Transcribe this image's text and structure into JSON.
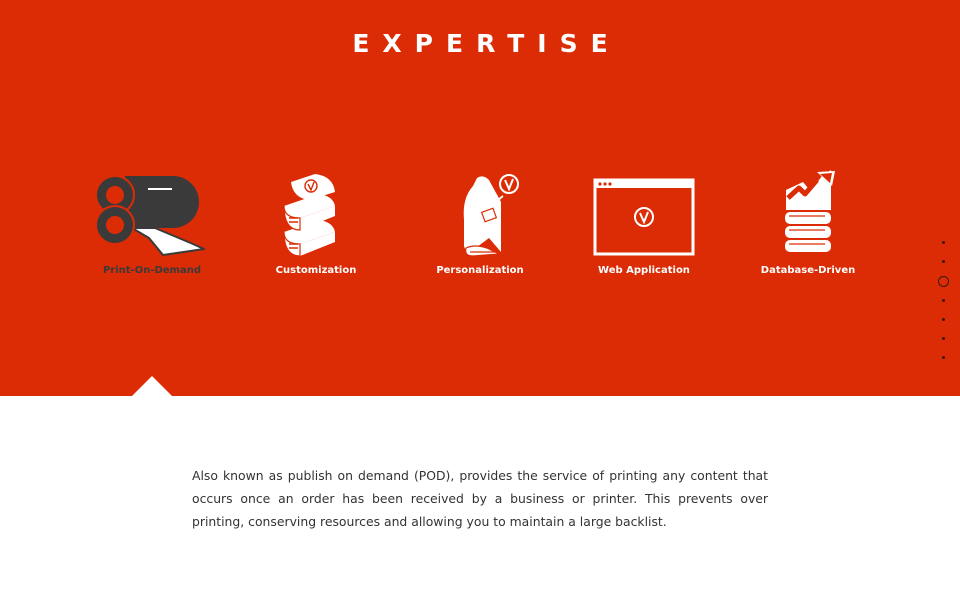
{
  "section": {
    "title": "EXPERTISE"
  },
  "features": [
    {
      "label": "Print-On-Demand",
      "icon": "printing-press-icon",
      "active": true
    },
    {
      "label": "Customization",
      "icon": "book-stack-icon",
      "active": false
    },
    {
      "label": "Personalization",
      "icon": "book-tag-icon",
      "active": false
    },
    {
      "label": "Web Application",
      "icon": "browser-window-icon",
      "active": false
    },
    {
      "label": "Database-Driven",
      "icon": "book-chart-icon",
      "active": false
    }
  ],
  "description": {
    "text": "Also known as publish on demand (POD), provides the service of printing any content that occurs once an order has been received by a business or printer. This prevents over printing, conserving resources and allowing you to maintain a large backlist."
  },
  "pager": {
    "count": 7,
    "current_index": 2
  },
  "colors": {
    "accent": "#db2c05",
    "dark": "#3a3a3a",
    "text": "#333333",
    "white": "#ffffff"
  }
}
